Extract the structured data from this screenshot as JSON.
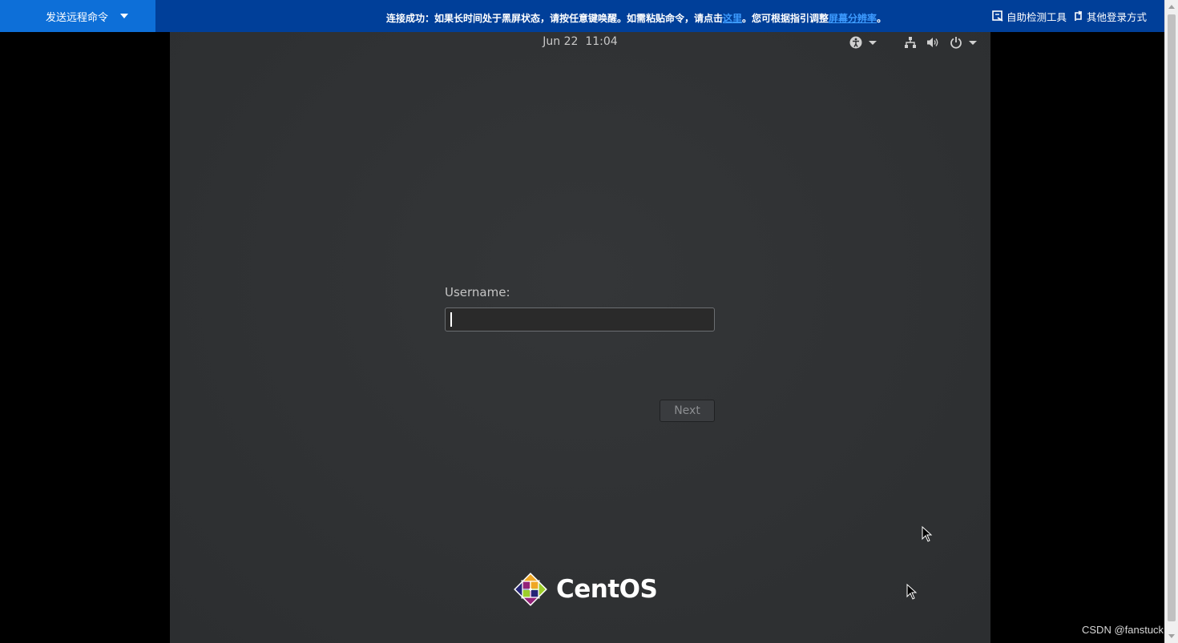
{
  "toolbar": {
    "send_command_label": "发送远程命令",
    "notice_prefix": "连接成功：如果长时间处于黑屏状态，请按任意键唤醒。如需粘贴命令，请点击",
    "notice_link1": "这里",
    "notice_middle": "。您可根据指引调整",
    "notice_link2": "屏幕分辨率",
    "notice_suffix": "。",
    "self_check_label": "自助检测工具",
    "other_login_label": "其他登录方式"
  },
  "topbar": {
    "date": "Jun 22",
    "time": "11:04",
    "icons": [
      "accessibility-icon",
      "network-icon",
      "volume-icon",
      "power-icon"
    ]
  },
  "login": {
    "username_label": "Username:",
    "username_value": "",
    "next_label": "Next"
  },
  "brand": {
    "logo_text": "CentOS"
  },
  "watermark": "CSDN @fanstuck",
  "colors": {
    "toolbar_bg": "#003f99",
    "send_btn_bg": "#0d6fd8",
    "link": "#3d9bff",
    "screen_bg": "#2f3133"
  }
}
